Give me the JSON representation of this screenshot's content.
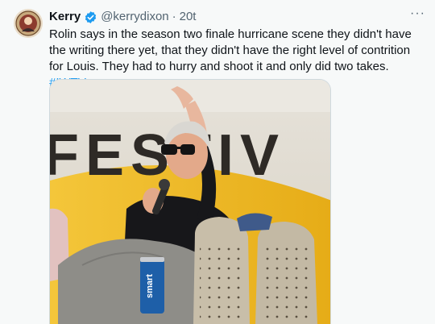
{
  "author": {
    "name": "Kerry",
    "handle": "@kerrydixon",
    "separator": "·",
    "time": "20t"
  },
  "more_menu": "···",
  "tweet": {
    "text": "Rolin says in the season two finale hurricane scene they didn't have the writing there yet, that they didn't have the right level of contrition for Louis. They had to hurry and shoot it and only did two takes. ",
    "hashtag": "#IWTV"
  },
  "photo": {
    "backdrop_text": "FESTIV",
    "can_brand": "smart"
  },
  "colors": {
    "accent": "#1d9bf0",
    "secondary_text": "#536471"
  }
}
